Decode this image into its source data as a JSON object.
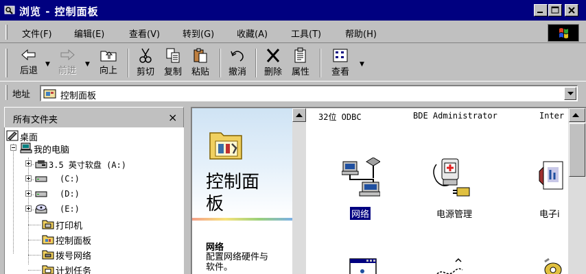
{
  "window": {
    "title": "浏览 - 控制面板",
    "icon": "explorer-window-icon"
  },
  "menu": [
    {
      "label": "文件(F)"
    },
    {
      "label": "编辑(E)"
    },
    {
      "label": "查看(V)"
    },
    {
      "label": "转到(G)"
    },
    {
      "label": "收藏(A)"
    },
    {
      "label": "工具(T)"
    },
    {
      "label": "帮助(H)"
    }
  ],
  "toolbar": {
    "back": "后退",
    "forward": "前进",
    "up": "向上",
    "cut": "剪切",
    "copy": "复制",
    "paste": "粘贴",
    "undo": "撤消",
    "delete": "删除",
    "properties": "属性",
    "views": "查看"
  },
  "address": {
    "label": "地址",
    "value": "控制面板"
  },
  "folders": {
    "title": "所有文件夹",
    "close": "×",
    "tree": [
      {
        "label": "桌面",
        "icon": "desktop-icon"
      },
      {
        "label": "我的电脑",
        "icon": "my-computer-icon"
      },
      {
        "label": "3.5 英寸软盘 (A:)",
        "icon": "floppy-drive-icon"
      },
      {
        "label": "(C:)",
        "icon": "hard-drive-icon"
      },
      {
        "label": "(D:)",
        "icon": "hard-drive-icon"
      },
      {
        "label": "(E:)",
        "icon": "cd-drive-icon"
      },
      {
        "label": "打印机",
        "icon": "printers-folder-icon"
      },
      {
        "label": "控制面板",
        "icon": "control-panel-folder-icon"
      },
      {
        "label": "拨号网络",
        "icon": "dialup-folder-icon"
      },
      {
        "label": "计划任务",
        "icon": "scheduled-tasks-folder-icon"
      }
    ]
  },
  "webview": {
    "title": "控制面板",
    "selected_name": "网络",
    "selected_desc": "配置网络硬件与软件。"
  },
  "items": {
    "headers": [
      "32位 ODBC",
      "BDE Administrator",
      "Inter"
    ],
    "icons": [
      {
        "label": "网络",
        "icon": "network-icon",
        "selected": true
      },
      {
        "label": "电源管理",
        "icon": "power-management-icon"
      },
      {
        "label": "电子i",
        "icon": "mail-icon"
      }
    ]
  },
  "colors": {
    "titlebar": "#000080",
    "face": "#c0c0c0",
    "selection": "#000080"
  }
}
